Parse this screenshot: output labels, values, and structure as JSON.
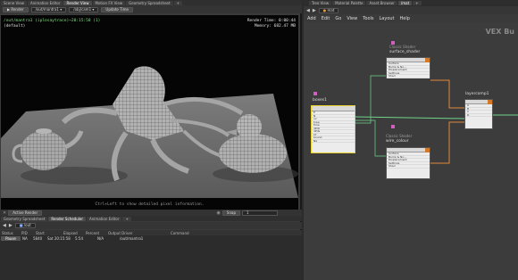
{
  "left_tabs": [
    "Scene View",
    "Animation Editor",
    "Render View",
    "Motion FX View",
    "Geometry Spreadsheet"
  ],
  "left_tab_active_index": 2,
  "render_toolbar": {
    "render_label": "Render",
    "target": "/out/mantra1",
    "camera": "/obj/cam1",
    "update_label": "Update Time"
  },
  "viewport": {
    "path_text": "/out/mantra1 (iplosaytrace)~20:15:58 (1)",
    "subline": "(default)",
    "render_time": "Render Time: 0:00:44",
    "memory": "Memory:  682.47 MB",
    "hint": "Ctrl+Left to show detailed pixel information."
  },
  "render_bar": {
    "active_label": "Active Render",
    "snap_label": "Snap",
    "snap_value": "1"
  },
  "bottom_tabs": [
    "Geometry Spreadsheet",
    "Render Scheduler",
    "Animation Editor"
  ],
  "bottom_tab_active_index": 1,
  "bottom_path": "/out",
  "table": {
    "headers": [
      "Status",
      "PID",
      "Start",
      "Elapsed",
      "Percent",
      "Output Driver",
      "Command"
    ],
    "rows": [
      [
        "Pause",
        "NA",
        "5840",
        "Sat 20:15:58",
        "5:54",
        "N/A",
        "/out/mantra1"
      ]
    ]
  },
  "right_tabs": [
    "Tree View",
    "Material Palette",
    "Asset Browser",
    "/mat"
  ],
  "right_tab_active_index": 3,
  "right_path": "mat",
  "menu": [
    "Add",
    "Edit",
    "Go",
    "View",
    "Tools",
    "Layout",
    "Help"
  ],
  "network_title": "VEX Bu",
  "nodes": {
    "surface": {
      "type": "Classic Shader",
      "name": "surface_shader",
      "rows": [
        "Surface",
        "Bump & No...",
        "Displacement",
        "Settings",
        "Shad"
      ]
    },
    "wire": {
      "type": "Classic Shader",
      "name": "wire_colour",
      "rows": [
        "Surface",
        "Bump & No...",
        "Displacement",
        "Settings",
        "Shad"
      ]
    },
    "boxes": {
      "name": "boxes1",
      "rows": [
        "P",
        "N",
        "uv",
        "type",
        "time",
        "dPdt",
        "dPds",
        "Cf",
        "bound",
        "Ng"
      ]
    },
    "layer": {
      "name": "layercomp1",
      "rows": [
        "A",
        "B",
        "C",
        "D"
      ]
    }
  }
}
